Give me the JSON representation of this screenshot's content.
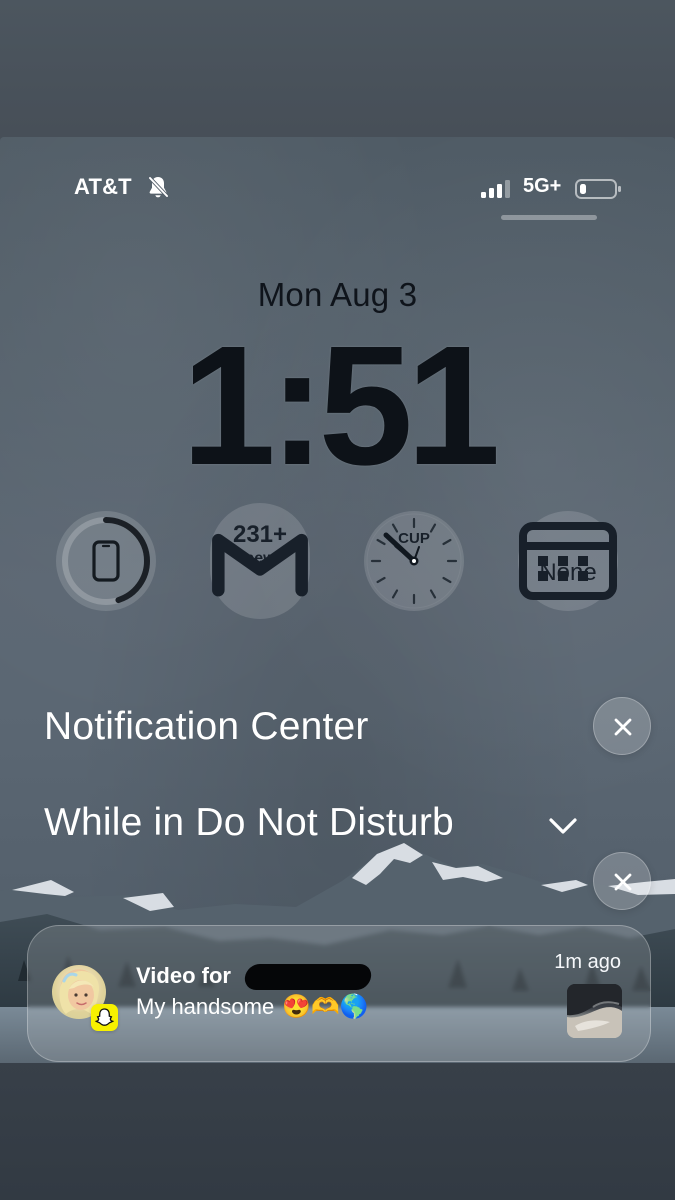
{
  "status_bar": {
    "carrier": "AT&T",
    "network": "5G+",
    "silent_icon": "bell-slash-icon",
    "signal_icon": "signal-bars-icon",
    "battery_icon": "battery-icon",
    "signal_strength": 0.75,
    "battery_level": 0.15
  },
  "lock_screen": {
    "date": "Mon Aug 3",
    "time": "1:51"
  },
  "widgets": [
    {
      "name": "phone-battery-widget",
      "icon": "phone-icon",
      "ring_level": 0.45
    },
    {
      "name": "gmail-widget",
      "count": "231+",
      "label": "new",
      "icon": "gmail-icon"
    },
    {
      "name": "world-clock-widget",
      "label": "CUP",
      "icon": "clock-icon"
    },
    {
      "name": "calendar-widget",
      "text": "None",
      "icon": "calendar-icon"
    }
  ],
  "sections": {
    "notification_center": "Notification Center",
    "while_in_dnd": "While in Do Not Disturb"
  },
  "notification": {
    "app": "Snapchat",
    "title": "Video for",
    "body": "My handsome",
    "emojis": "😍🫶🌎",
    "time": "1m ago"
  },
  "colors": {
    "text_dark": "#0f141b",
    "text_light": "#ffffff",
    "snapchat_yellow": "#f7f100"
  }
}
